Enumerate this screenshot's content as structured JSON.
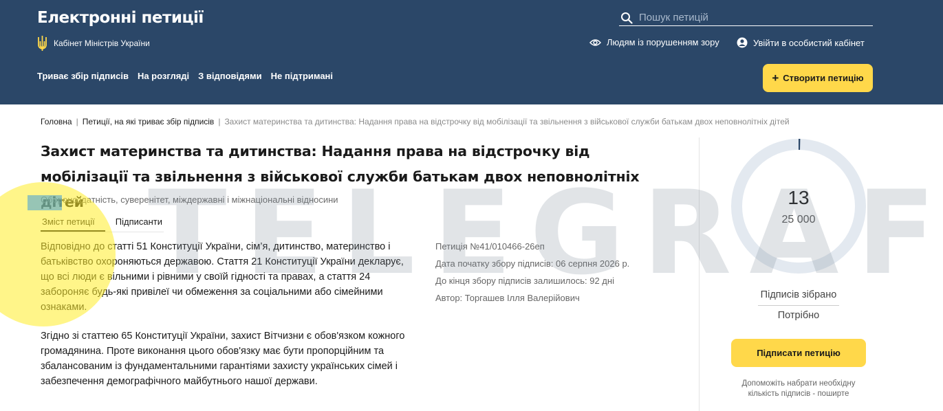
{
  "header": {
    "site_title": "Електронні петиції",
    "cabinet_label": "Кабінет Міністрів України",
    "search_placeholder": "Пошук петицій",
    "accessibility_label": "Людям із порушенням зору",
    "login_label": "Увійти в особистий кабінет",
    "nav": [
      {
        "label": "Триває збір підписів"
      },
      {
        "label": "На розгляді"
      },
      {
        "label": "З відповідями"
      },
      {
        "label": "Не підтримані"
      }
    ],
    "create_button": "Створити петицію"
  },
  "breadcrumb": {
    "home": "Головна",
    "section": "Петиції, на які триває збір підписів",
    "current": "Захист материнства та дитинства: Надання права на відстрочку від мобілізації та звільнення з військової служби батькам двох неповнолітніх дітей"
  },
  "petition": {
    "title": "Захист материнства та дитинства: Надання права на відстрочку від мобілізації та звільнення з військової служби батькам двох неповнолітніх дітей",
    "category": "Обороноздатність, суверенітет, міждержавні і міжнаціональні відносини",
    "tabs": [
      {
        "label": "Зміст петиції",
        "active": true
      },
      {
        "label": "Підписанти",
        "active": false
      }
    ],
    "paragraphs": [
      "Відповідно до статті 51 Конституції України, сім’я, дитинство, материнство і батьківство охороняються державою. Стаття 21 Конституції України декларує, що всі люди є вільними і рівними у своїй гідності та правах, а стаття 24 забороняє будь-які привілеї чи обмеження за соціальними або сімейними ознаками.",
      "Згідно зі статтею 65 Конституції України, захист Вітчизни є обов'язком кожного громадянина. Проте виконання цього обов'язку має бути пропорційним та збалансованим із фундаментальними гарантіями захисту українських сімей і забезпечення демографічного майбутнього нашої держави."
    ],
    "meta": {
      "number": "Петиція №41/010466-26еп",
      "start_date": "Дата початку збору підписів: 06 серпня 2026 р.",
      "remaining": "До кінця збору підписів залишилось: 92 дні",
      "author": "Автор: Торгашев Ілля Валерійович"
    }
  },
  "signatures": {
    "collected": "13",
    "required": "25 000",
    "progress_fraction": 0.00052,
    "collected_label": "Підписів зібрано",
    "required_label": "Потрібно",
    "sign_button": "Підписати петицію",
    "share_note": "Допоможіть набрати необхідну кількість підписів - поширте"
  },
  "watermark": {
    "text": "TELEGRAF"
  },
  "colors": {
    "header_bg": "#2b4768",
    "accent_yellow": "#ffd84a",
    "ring_track": "#e3e9f0",
    "ring_progress": "#2b4768"
  }
}
